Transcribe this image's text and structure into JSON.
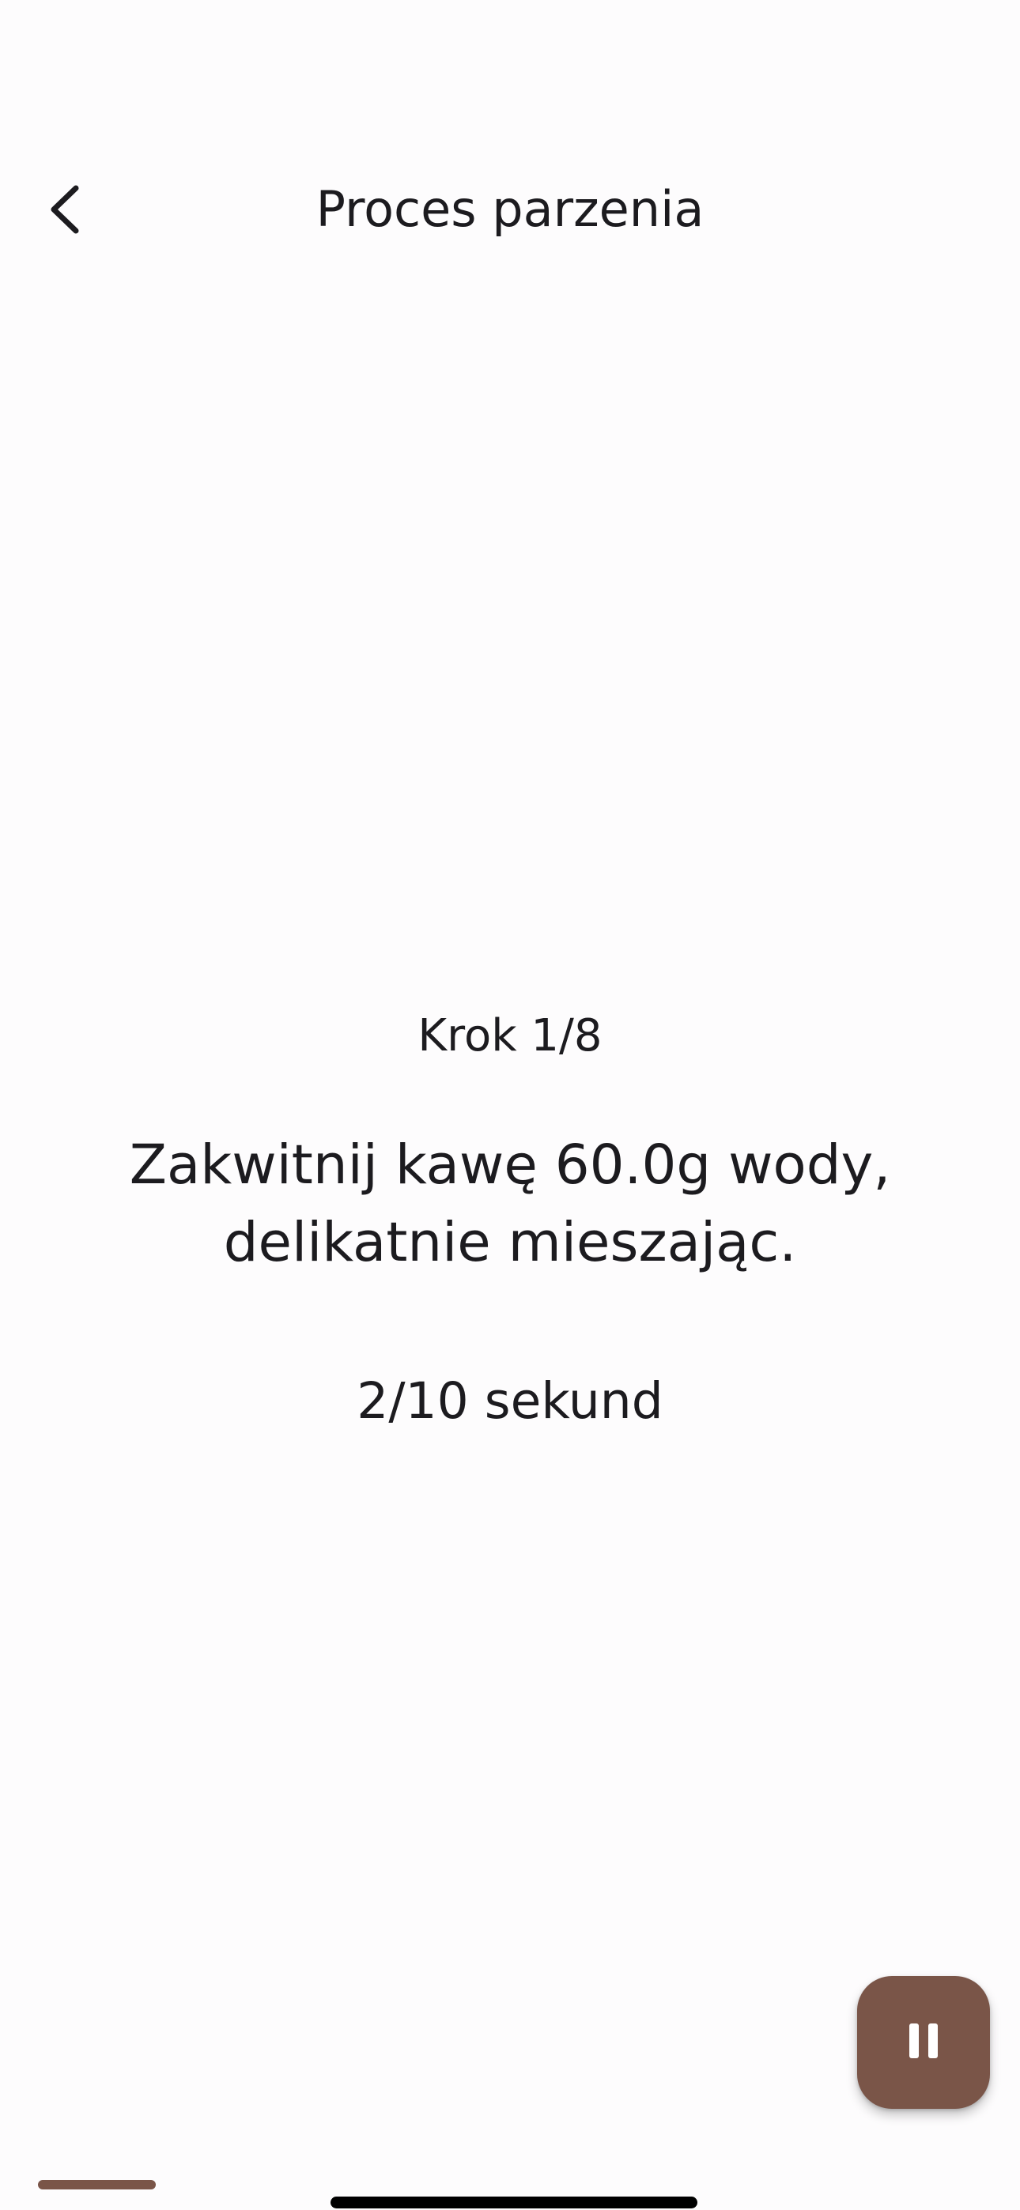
{
  "app_bar": {
    "title": "Proces parzenia",
    "back_icon": "chevron-left-icon"
  },
  "step": {
    "counter": "Krok 1/8",
    "instruction": "Zakwitnij kawę 60.0g wody, delikatnie mieszając.",
    "timer": "2/10 sekund"
  },
  "fab": {
    "icon": "pause-icon"
  },
  "progress": {
    "fraction": 0.125
  },
  "colors": {
    "accent": "#7a5548",
    "background": "#fdfcfd",
    "text": "#1c1b1f"
  }
}
